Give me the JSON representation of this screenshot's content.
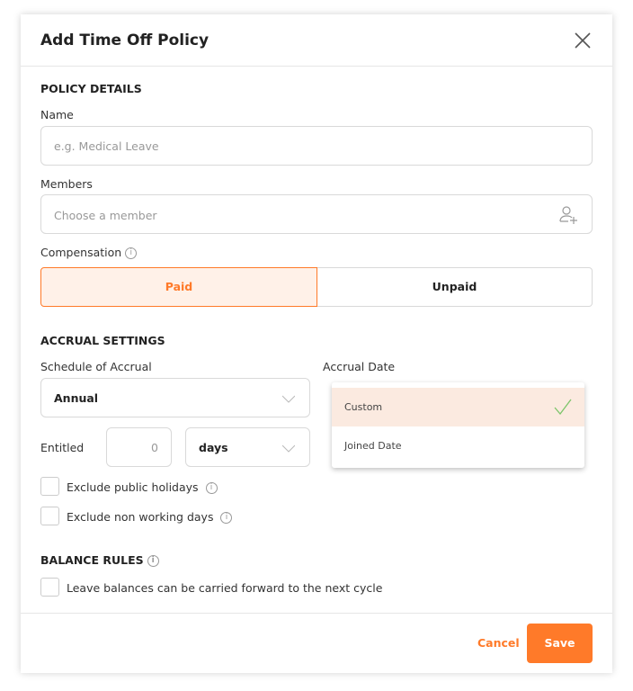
{
  "modal": {
    "title": "Add Time Off Policy"
  },
  "policy_details": {
    "heading": "POLICY DETAILS",
    "name_label": "Name",
    "name_placeholder": "e.g. Medical Leave",
    "members_label": "Members",
    "members_placeholder": "Choose a member",
    "compensation_label": "Compensation",
    "options": [
      "Paid",
      "Unpaid"
    ],
    "selected": "Paid"
  },
  "accrual": {
    "heading": "ACCRUAL SETTINGS",
    "schedule_label": "Schedule of Accrual",
    "schedule_value": "Annual",
    "date_label": "Accrual Date",
    "date_options": [
      {
        "label": "Custom",
        "selected": true
      },
      {
        "label": "Joined Date",
        "selected": false
      }
    ],
    "entitled_label": "Entitled",
    "entitled_value": "0",
    "unit_value": "days",
    "exclude_holidays": "Exclude public holidays",
    "exclude_nonworking": "Exclude non working days"
  },
  "balance": {
    "heading": "BALANCE RULES",
    "carry_forward": "Leave balances can be carried forward to the next cycle"
  },
  "footer": {
    "cancel": "Cancel",
    "save": "Save"
  },
  "colors": {
    "accent": "#ff7a29",
    "accent_bg": "#fff1e8",
    "check": "#7cc56a"
  }
}
